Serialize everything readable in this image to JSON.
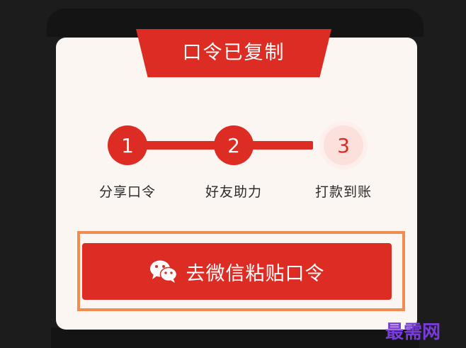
{
  "dialog": {
    "title": "口令已复制",
    "steps": [
      {
        "number": "1",
        "label": "分享口令"
      },
      {
        "number": "2",
        "label": "好友助力"
      },
      {
        "number": "3",
        "label": "打款到账"
      }
    ],
    "completed_steps": 2,
    "cta_label": "去微信粘贴口令",
    "cta_icon": "wechat-icon"
  },
  "watermark": "最需网",
  "colors": {
    "accent": "#dd2c23",
    "card": "#fbf6f1",
    "highlight_outline": "#f08c4f",
    "watermark": "#7a3bdc"
  }
}
